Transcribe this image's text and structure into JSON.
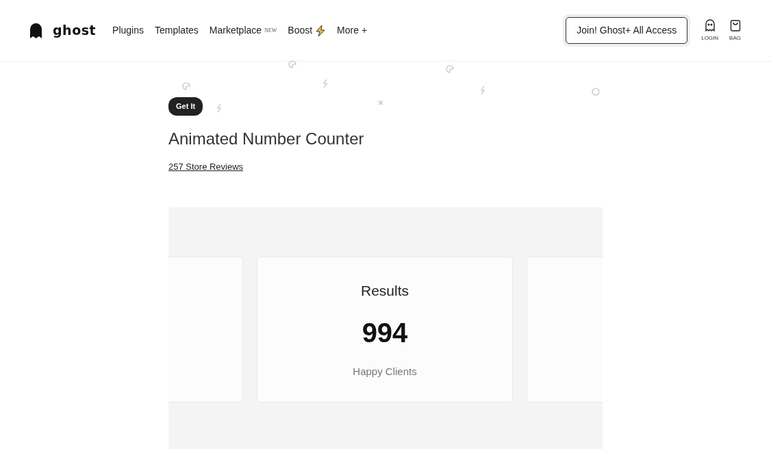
{
  "header": {
    "logo": "ghost",
    "nav": [
      {
        "kind": "text",
        "label": "Plugins"
      },
      {
        "kind": "text",
        "label": "Templates"
      },
      {
        "kind": "text",
        "label": "Marketplace",
        "badge": "NEW"
      },
      {
        "kind": "boost",
        "label": "Boost"
      },
      {
        "kind": "text",
        "label": "More +"
      }
    ],
    "cta": "Join! Ghost+ All Access",
    "actions": [
      {
        "kind": "login",
        "label": "LOGIN"
      },
      {
        "kind": "bag",
        "label": "BAG"
      }
    ]
  },
  "product": {
    "tag": "Get It",
    "title": "Animated Number Counter",
    "reviews": "257 Store Reviews"
  },
  "demo": {
    "cards": [
      {
        "kind": "partial"
      },
      {
        "kind": "counter",
        "title": "Results",
        "number": "994",
        "caption": "Happy Clients"
      },
      {
        "kind": "partial"
      }
    ]
  }
}
